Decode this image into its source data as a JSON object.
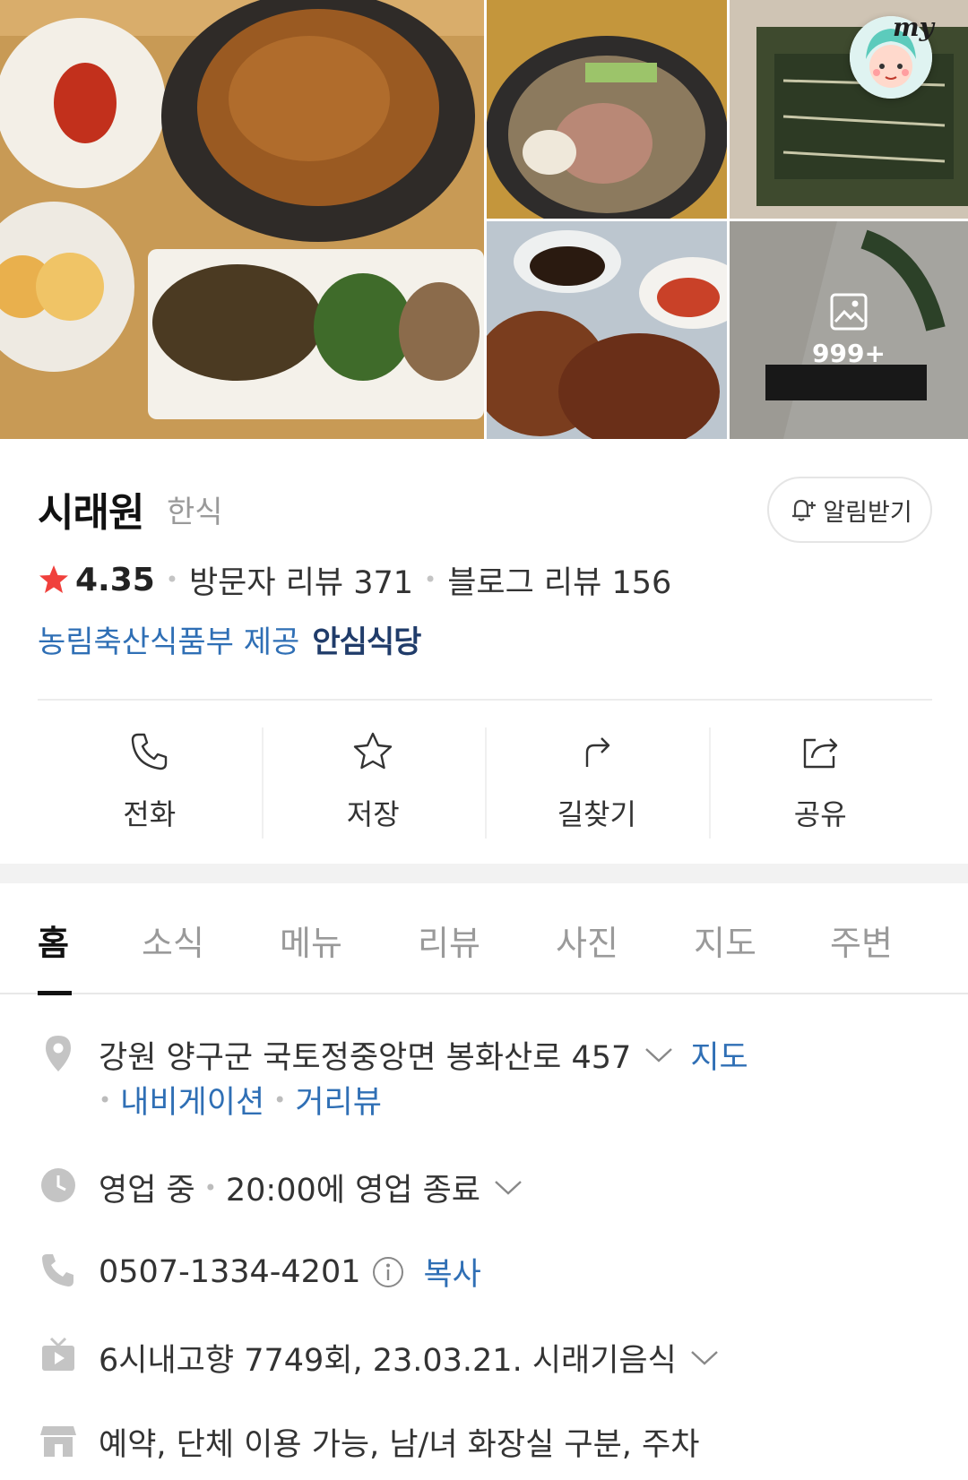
{
  "badges": {
    "my_label": "my",
    "more_photos_count": "999+"
  },
  "place": {
    "name": "시래원",
    "category": "한식",
    "alarm_label": "알림받기",
    "rating": "4.35",
    "visitor_reviews": "방문자 리뷰 371",
    "blog_reviews": "블로그 리뷰 156",
    "certification_provider": "농림축산식품부 제공",
    "certification_name": "안심식당"
  },
  "actions": [
    {
      "label": "전화",
      "icon": "phone-icon"
    },
    {
      "label": "저장",
      "icon": "star-outline-icon"
    },
    {
      "label": "길찾기",
      "icon": "directions-icon"
    },
    {
      "label": "공유",
      "icon": "share-icon"
    }
  ],
  "tabs": [
    {
      "label": "홈",
      "active": true
    },
    {
      "label": "소식"
    },
    {
      "label": "메뉴"
    },
    {
      "label": "리뷰"
    },
    {
      "label": "사진"
    },
    {
      "label": "지도"
    },
    {
      "label": "주변"
    }
  ],
  "info": {
    "address": "강원 양구군 국토정중앙면 봉화산로 457",
    "address_map_link": "지도",
    "navigation_link": "내비게이션",
    "streetview_link": "거리뷰",
    "status": "영업 중",
    "close_time": "20:00에 영업 종료",
    "phone": "0507-1334-4201",
    "copy_label": "복사",
    "tv_info": "6시내고향 7749회, 23.03.21. 시래기음식",
    "amenities": "예약, 단체 이용 가능, 남/녀 화장실 구분, 주차"
  },
  "colors": {
    "link": "#2f6fb5",
    "star": "#f0403c",
    "cert": "#203c6a"
  }
}
